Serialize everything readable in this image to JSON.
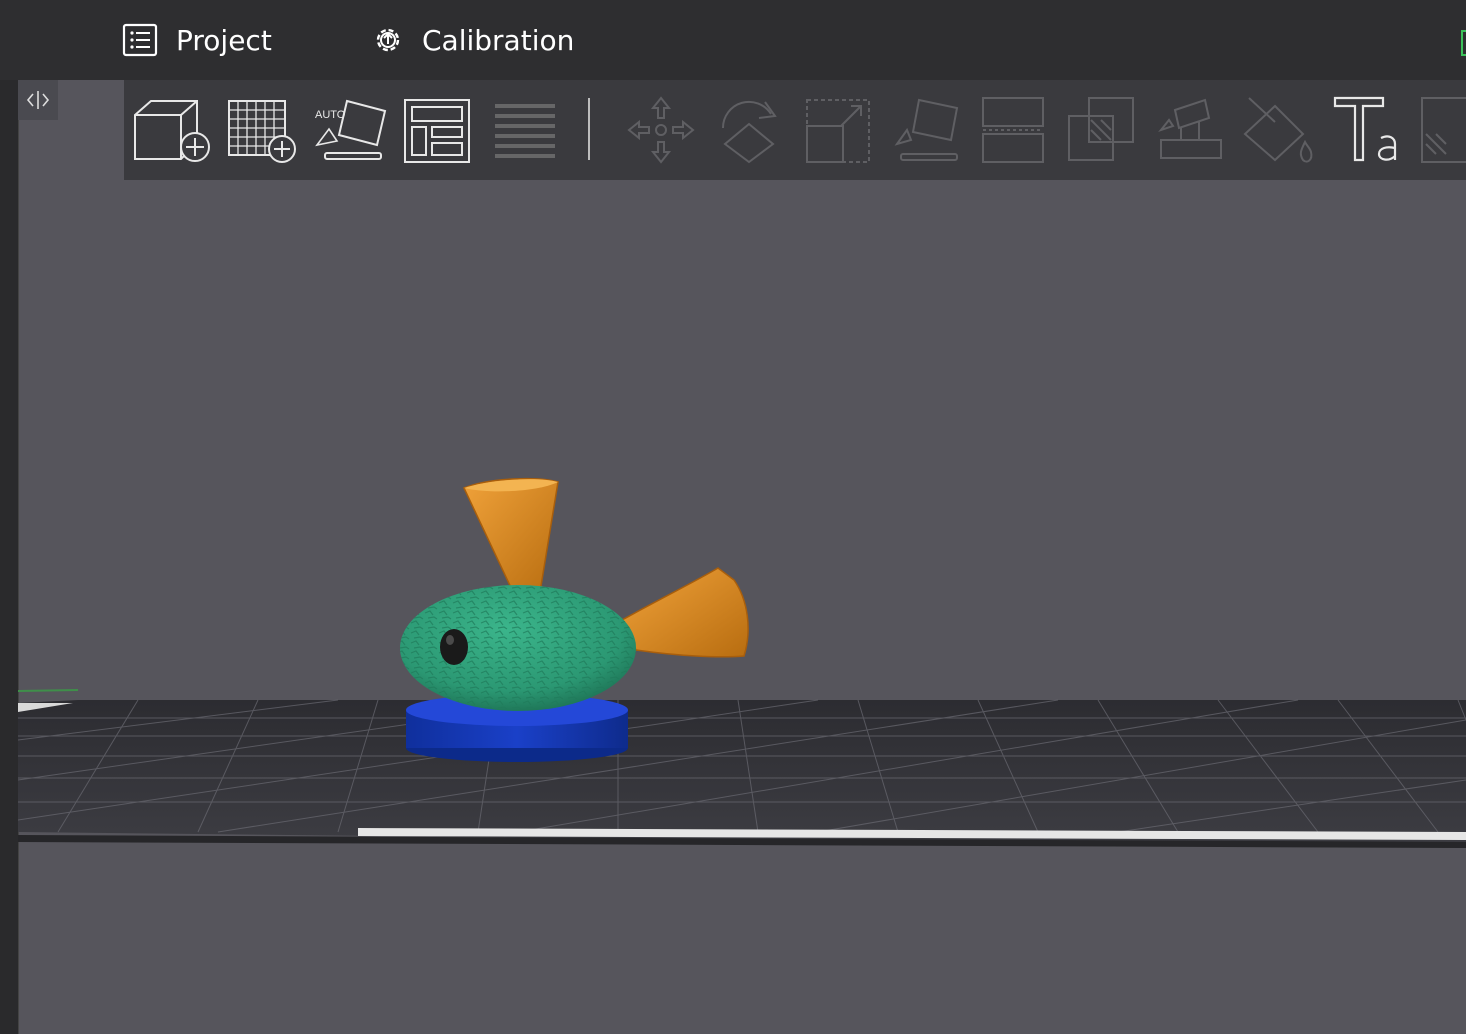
{
  "tabs": [
    {
      "label": "Project",
      "icon": "list-icon"
    },
    {
      "label": "Calibration",
      "icon": "gear-icon"
    }
  ],
  "toolbar": {
    "tools": [
      {
        "name": "add-object",
        "icon": "cube-plus-icon"
      },
      {
        "name": "add-plate",
        "icon": "grid-plus-icon"
      },
      {
        "name": "auto-orient",
        "icon": "auto-orient-icon",
        "badge": "AUTO"
      },
      {
        "name": "arrange",
        "icon": "layout-icon"
      },
      {
        "name": "layers",
        "icon": "lines-icon"
      },
      {
        "name": "move",
        "icon": "move-icon"
      },
      {
        "name": "rotate",
        "icon": "rotate-icon"
      },
      {
        "name": "scale",
        "icon": "scale-icon"
      },
      {
        "name": "lay-on-face",
        "icon": "lay-on-face-icon"
      },
      {
        "name": "cut",
        "icon": "cut-icon"
      },
      {
        "name": "boolean",
        "icon": "boolean-icon"
      },
      {
        "name": "supports",
        "icon": "support-paint-icon"
      },
      {
        "name": "color-paint",
        "icon": "paint-bucket-icon"
      },
      {
        "name": "text",
        "icon": "text-tool-icon"
      },
      {
        "name": "measure",
        "icon": "partial-icon"
      }
    ]
  },
  "colors": {
    "accent_green": "#3cc15a",
    "body_green": "#2f9e78",
    "fin_orange": "#d9891c",
    "base_blue": "#1238b5",
    "viewport_bg": "#56555c"
  }
}
